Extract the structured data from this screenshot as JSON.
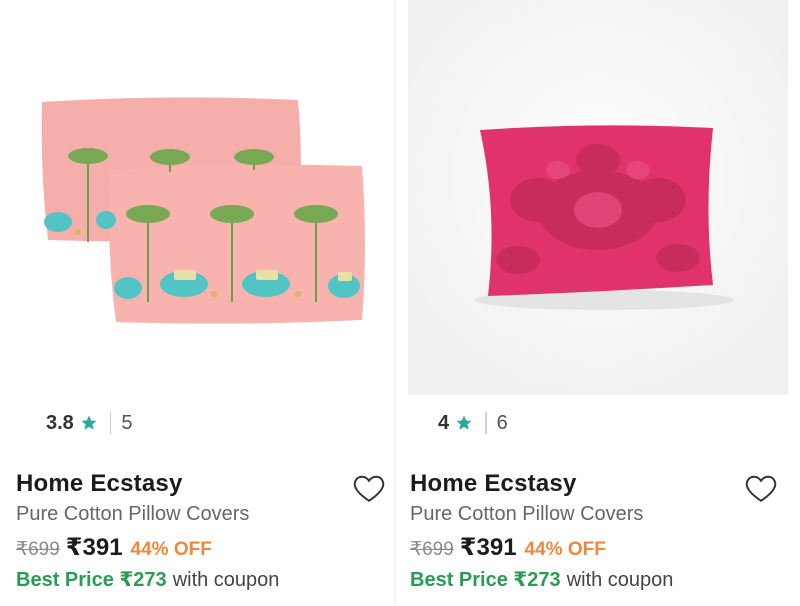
{
  "products": [
    {
      "image_alt": "pink-pillow-covers-palm-elephant-print",
      "rating": "3.8",
      "rating_count": "5",
      "brand": "Home Ecstasy",
      "title": "Pure Cotton Pillow Covers",
      "mrp": "₹699",
      "price": "₹391",
      "discount": "44% OFF",
      "best_price_label": "Best Price ₹273",
      "best_price_suffix": "with coupon"
    },
    {
      "image_alt": "magenta-damask-pillow-cover",
      "rating": "4",
      "rating_count": "6",
      "brand": "Home Ecstasy",
      "title": "Pure Cotton Pillow Covers",
      "mrp": "₹699",
      "price": "₹391",
      "discount": "44% OFF",
      "best_price_label": "Best Price ₹273",
      "best_price_suffix": "with coupon"
    }
  ],
  "colors": {
    "star": "#2aa89a",
    "best_price": "#2a9b56",
    "discount": "#f0873c",
    "pillow_pink": "#f7b0ad",
    "pillow_magenta": "#e0336b"
  },
  "icons": {
    "rating": "star-icon",
    "wishlist": "heart-outline-icon"
  }
}
